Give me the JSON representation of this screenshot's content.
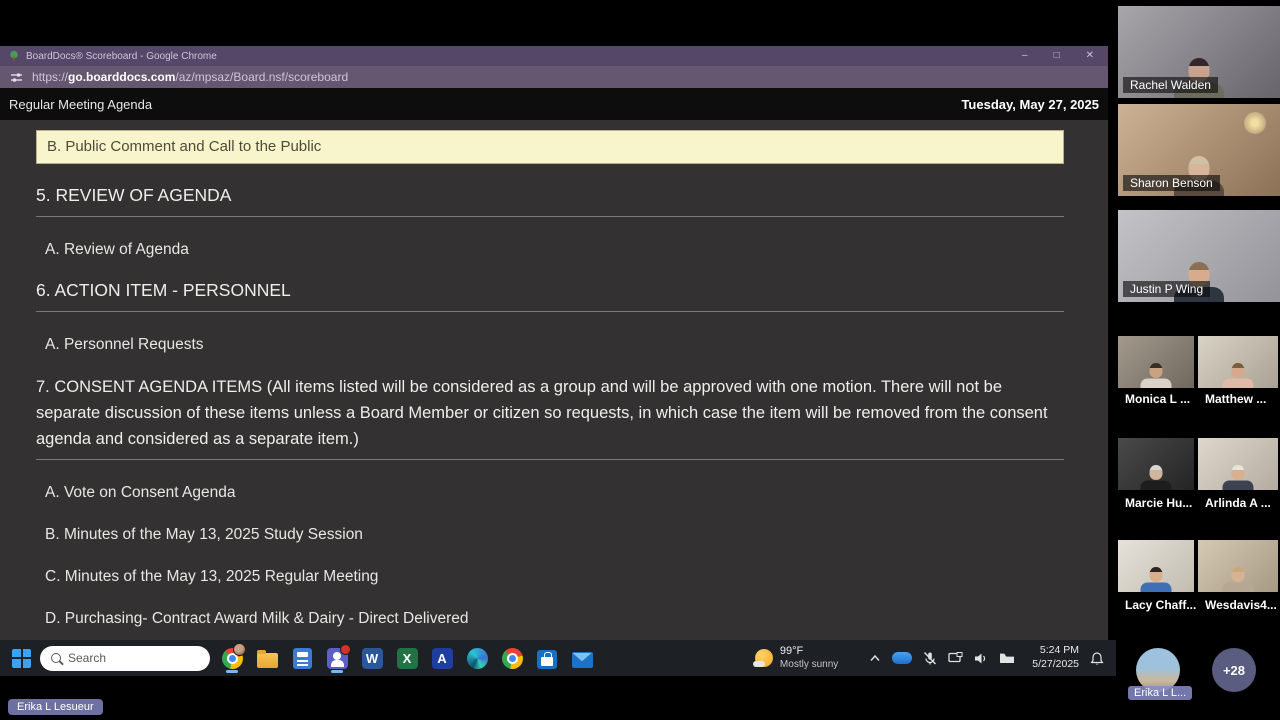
{
  "colors": {
    "titlebar": "#554768",
    "urlbar": "#65576f",
    "page-header-bg": "#0d0d0d",
    "page-bg": "#333132",
    "highlight-bg": "#f8f5cd",
    "highlight-text": "#4c4c39",
    "agenda-text": "#e9e7e4",
    "taskbar-bg": "#1d2025",
    "overflow-bg": "#5a5c80"
  },
  "browser": {
    "window_title": "BoardDocs® Scoreboard - Google Chrome",
    "url": {
      "protocol": "https://",
      "host": "go.boarddocs.com",
      "path": "/az/mpsaz/Board.nsf/scoreboard"
    }
  },
  "page": {
    "title": "Regular Meeting Agenda",
    "date": "Tuesday, May 27, 2025"
  },
  "agenda": [
    {
      "type": "highlight",
      "text": "B. Public Comment and Call to the Public"
    },
    {
      "type": "section",
      "text": "5. REVIEW OF AGENDA"
    },
    {
      "type": "item",
      "text": "A. Review of Agenda"
    },
    {
      "type": "section",
      "text": "6. ACTION ITEM - PERSONNEL"
    },
    {
      "type": "item",
      "text": "A. Personnel Requests"
    },
    {
      "type": "section",
      "text": "7. CONSENT AGENDA ITEMS (All items listed will be considered as a group and will be approved with one motion. There will not be separate discussion of these items unless a Board Member or citizen so requests, in which case the item will be removed from the consent agenda and considered as a separate item.)"
    },
    {
      "type": "item",
      "text": "A. Vote on Consent Agenda"
    },
    {
      "type": "item",
      "text": "B. Minutes of the May 13, 2025 Study Session"
    },
    {
      "type": "item",
      "text": "C. Minutes of the May 13, 2025 Regular Meeting"
    },
    {
      "type": "item",
      "text": "D. Purchasing- Contract Award Milk & Dairy - Direct Delivered"
    }
  ],
  "taskbar": {
    "search_placeholder": "Search",
    "weather": {
      "temp": "99°F",
      "condition": "Mostly sunny"
    },
    "clock": {
      "time": "5:24 PM",
      "date": "5/27/2025"
    },
    "app_icons": [
      "chrome",
      "file-explorer",
      "calculator",
      "teams",
      "word",
      "excel",
      "app-a",
      "edge",
      "chrome",
      "store",
      "mail"
    ],
    "tray_icons": [
      "chevron-up",
      "bluetooth-device",
      "mic-muted",
      "display",
      "speaker",
      "onedrive-folder",
      "notification-bell"
    ]
  },
  "participants": [
    {
      "name": "Rachel Walden"
    },
    {
      "name": "Sharon Benson"
    },
    {
      "name": "Justin P Wing"
    },
    {
      "name": "Monica L ..."
    },
    {
      "name": "Matthew ..."
    },
    {
      "name": "Marcie Hu..."
    },
    {
      "name": "Arlinda A ..."
    },
    {
      "name": "Lacy Chaff..."
    },
    {
      "name": "Wesdavis4..."
    },
    {
      "name": "Erika L L..."
    }
  ],
  "overflow_count": "+28",
  "self_label": "Erika L Lesueur"
}
